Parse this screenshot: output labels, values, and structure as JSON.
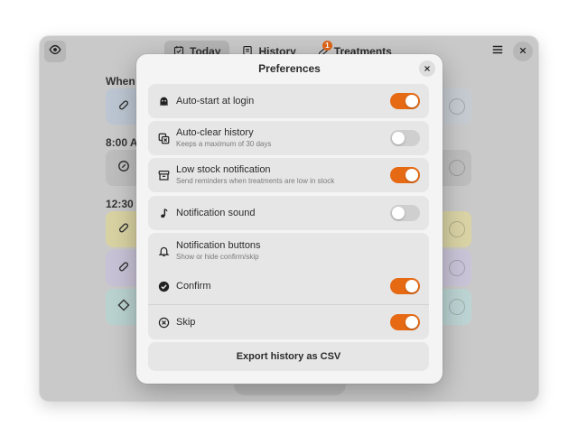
{
  "app": {
    "tabs": [
      {
        "label": "Today",
        "icon": "calendar-check-icon",
        "active": true
      },
      {
        "label": "History",
        "icon": "history-icon",
        "active": false
      },
      {
        "label": "Treatments",
        "icon": "pills-icon",
        "active": false,
        "badge": "1"
      }
    ],
    "sections": [
      "When n",
      "8:00 A",
      "12:30"
    ],
    "card_colors": [
      "#bcc6d2",
      "#bdbdbd",
      "#d8d2a2",
      "#c7c2d6",
      "#b9d2d0"
    ],
    "right_card_colors": [
      "#c5cbd1",
      "#bdbdbd",
      "#d9d3a5",
      "#c9c4d8",
      "#bcd4d3"
    ]
  },
  "dialog": {
    "title": "Preferences",
    "rows": [
      {
        "title": "Auto-start at login",
        "subtitle": "",
        "icon": "ghost-icon",
        "on": true
      },
      {
        "title": "Auto-clear history",
        "subtitle": "Keeps a maximum of 30 days",
        "icon": "history-clear-icon",
        "on": false
      },
      {
        "title": "Low stock notification",
        "subtitle": "Send reminders when treatments are low in stock",
        "icon": "box-icon",
        "on": true
      },
      {
        "title": "Notification sound",
        "subtitle": "",
        "icon": "music-note-icon",
        "on": false
      },
      {
        "title": "Notification buttons",
        "subtitle": "Show or hide confirm/skip",
        "icon": "bell-icon"
      },
      {
        "title": "Confirm",
        "subtitle": "",
        "icon": "check-circle-icon",
        "on": true
      },
      {
        "title": "Skip",
        "subtitle": "",
        "icon": "x-circle-icon",
        "on": true
      }
    ],
    "export_label": "Export history as CSV"
  },
  "colors": {
    "accent": "#e66a14",
    "switch_off": "#cfcfcf"
  }
}
